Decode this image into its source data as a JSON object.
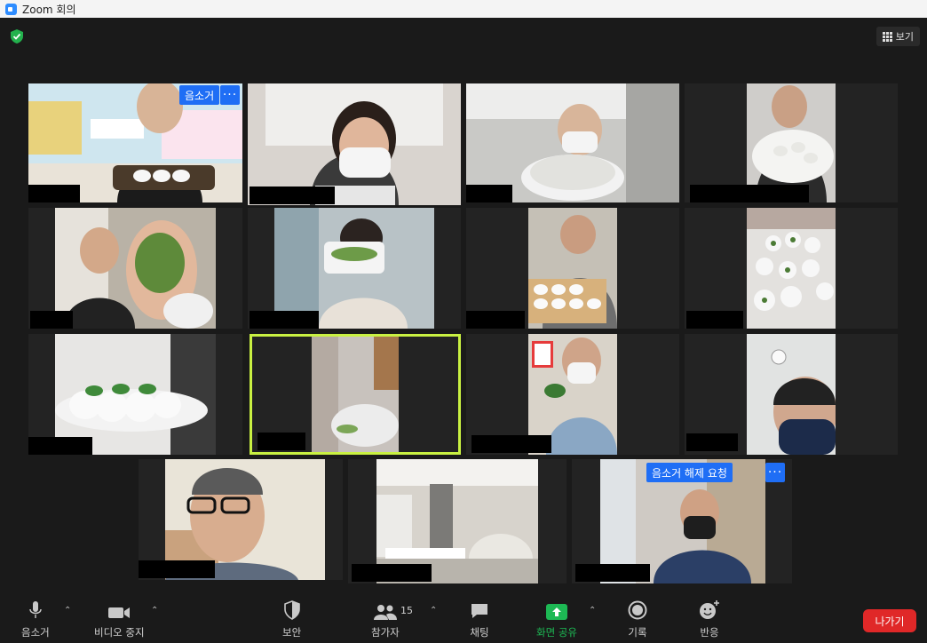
{
  "window": {
    "title": "Zoom 회의"
  },
  "header": {
    "view_label": "보기"
  },
  "colors": {
    "accent_blue": "#1f6ef5",
    "leave_red": "#e02828",
    "active_speaker": "#c9f142",
    "share_green": "#1db954"
  },
  "participants": {
    "badges": {
      "mute": "음소거",
      "unmute_request": "음소거 해제 요청",
      "more": "···"
    }
  },
  "toolbar": {
    "mute": "음소거",
    "video": "비디오 중지",
    "security": "보안",
    "participants": "참가자",
    "participant_count": "15",
    "chat": "채팅",
    "share": "화면 공유",
    "record": "기록",
    "reactions": "반응",
    "leave": "나가기"
  }
}
